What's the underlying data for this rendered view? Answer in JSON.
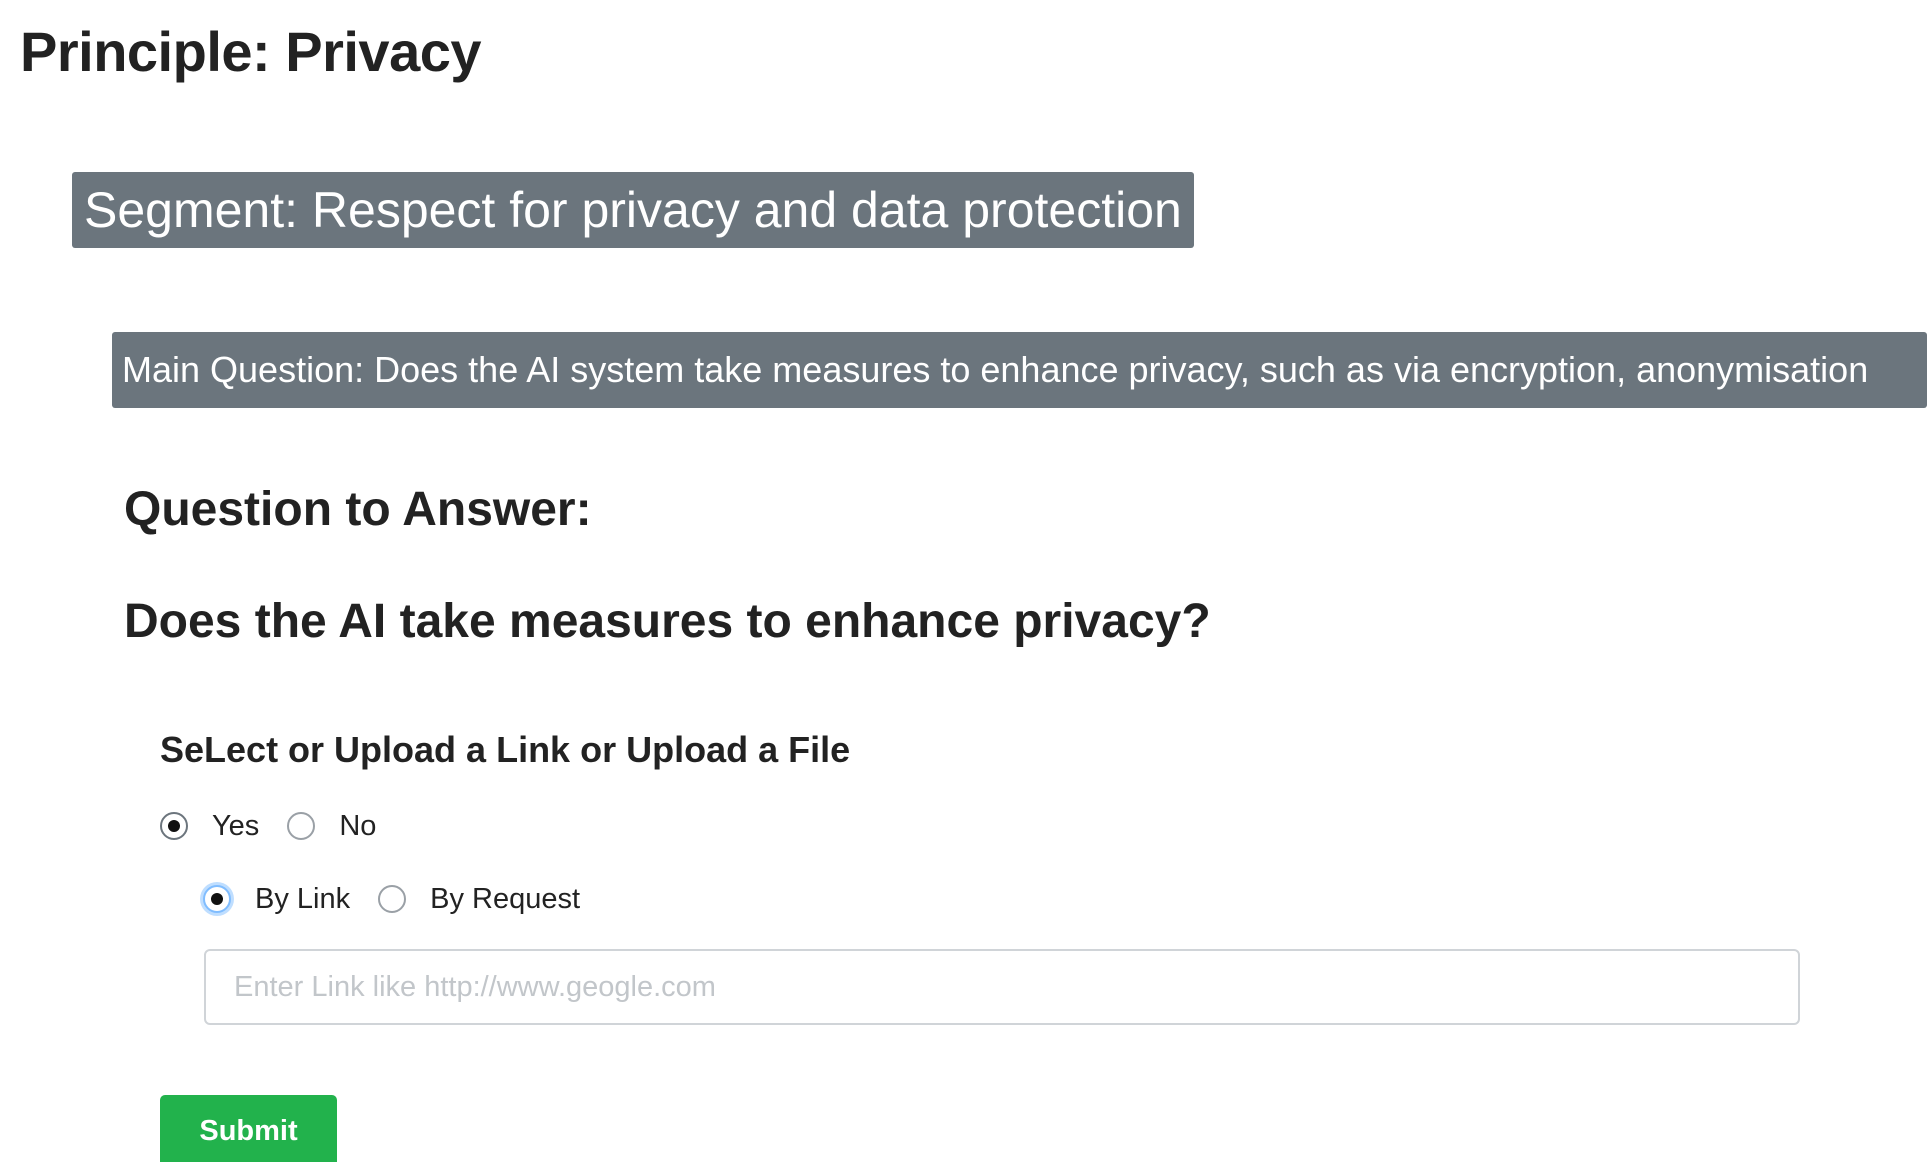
{
  "page": {
    "title": "Principle: Privacy"
  },
  "segment": {
    "text": "Segment:  Respect for privacy and data protection"
  },
  "main_question": {
    "text": "Main Question:  Does the AI system take measures to enhance privacy, such as via encryption, anonymisation"
  },
  "question_section": {
    "heading": "Question to Answer:",
    "question": "Does the AI take measures to enhance privacy?"
  },
  "form": {
    "label": "SeLect or Upload a Link or Upload a File",
    "answer_options": [
      {
        "label": "Yes",
        "checked": true
      },
      {
        "label": "No",
        "checked": false
      }
    ],
    "method_options": [
      {
        "label": "By Link",
        "checked": true
      },
      {
        "label": "By Request",
        "checked": false
      }
    ],
    "link_input": {
      "value": "",
      "placeholder": "Enter Link like http://www.geogle.com"
    },
    "submit_label": "Submit"
  },
  "colors": {
    "banner_bg": "#6b757d",
    "submit_bg": "#22b24c"
  }
}
